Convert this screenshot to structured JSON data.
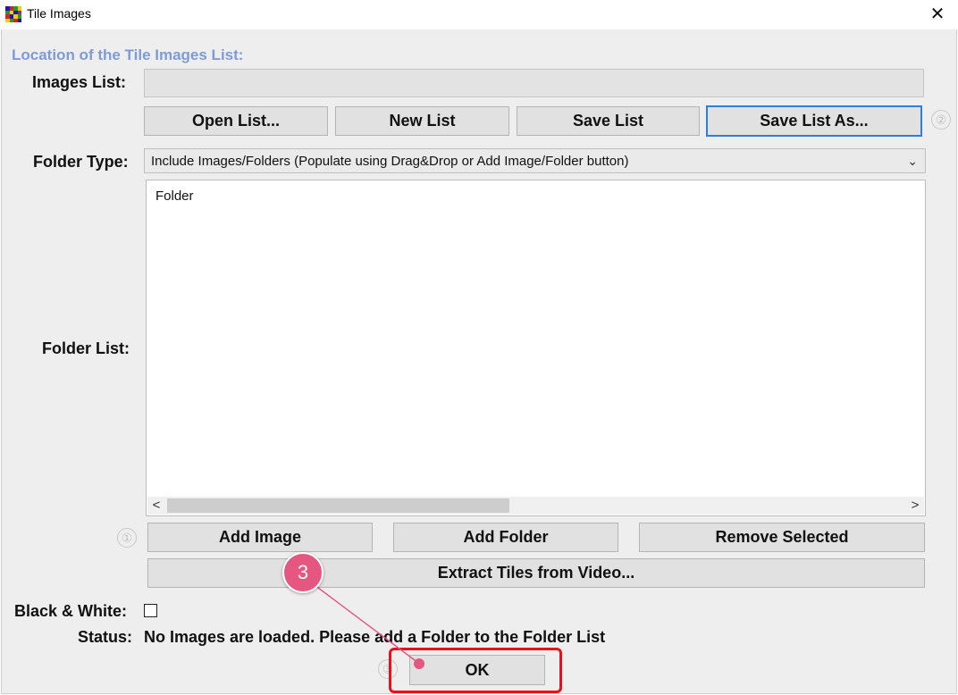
{
  "window": {
    "title": "Tile Images",
    "close_glyph": "✕"
  },
  "section": {
    "heading": "Location of the Tile Images List:"
  },
  "images_list": {
    "label": "Images List:",
    "value": ""
  },
  "list_buttons": {
    "open": "Open List...",
    "new": "New List",
    "save": "Save List",
    "save_as": "Save List As..."
  },
  "hints": {
    "two": "②",
    "one": "①",
    "three": "③"
  },
  "folder_type": {
    "label": "Folder Type:",
    "selected": "Include Images/Folders (Populate using Drag&Drop or Add Image/Folder button)",
    "chevron": "⌄"
  },
  "folder_list": {
    "label": "Folder List:",
    "items": [
      "Folder"
    ],
    "scroll_left": "<",
    "scroll_right": ">"
  },
  "folder_buttons": {
    "add_image": "Add Image",
    "add_folder": "Add Folder",
    "remove_selected": "Remove Selected",
    "extract_tiles": "Extract Tiles from Video..."
  },
  "black_white": {
    "label": "Black & White:",
    "checked": false
  },
  "status": {
    "label": "Status:",
    "text": "No Images are loaded. Please add a Folder to the Folder List"
  },
  "ok_button": {
    "label": "OK"
  },
  "callout": {
    "number": "3",
    "color": "#e55780",
    "highlight_color": "#e8101b"
  },
  "colors": {
    "heading": "#7f9bd6",
    "focus_border": "#2f7fd8",
    "dialog_bg": "#eeeeee"
  }
}
